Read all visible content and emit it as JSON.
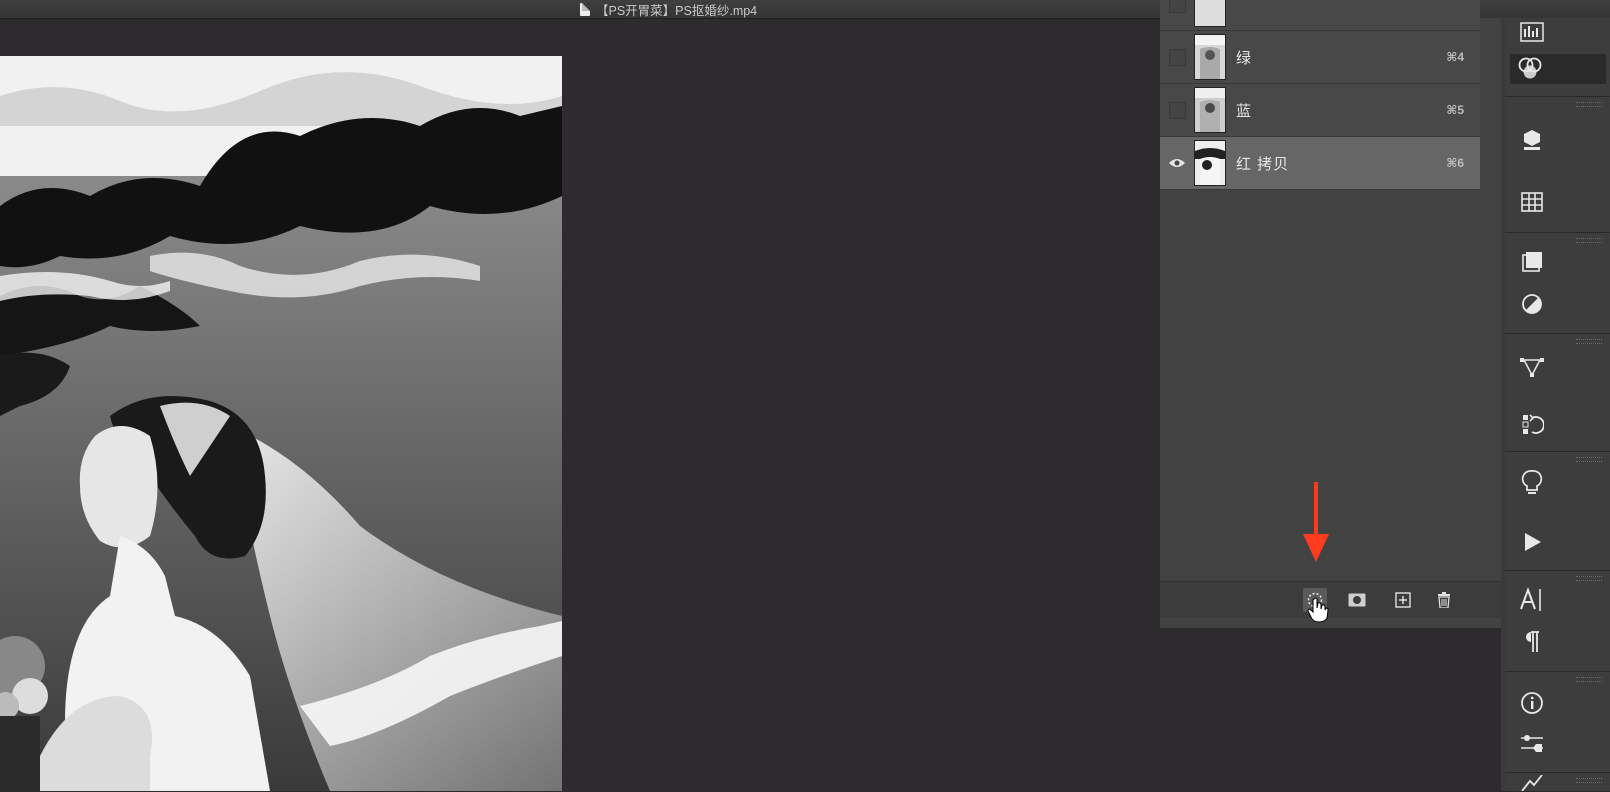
{
  "window": {
    "title": "【PS开胃菜】PS抠婚纱.mp4"
  },
  "layers": [
    {
      "name": "绿",
      "shortcut": "⌘4",
      "visible": false,
      "selected": false
    },
    {
      "name": "蓝",
      "shortcut": "⌘5",
      "visible": false,
      "selected": false
    },
    {
      "name": "红 拷贝",
      "shortcut": "⌘6",
      "visible": true,
      "selected": true
    }
  ],
  "footer_buttons": [
    "load-channel-as-selection",
    "save-selection-as-channel",
    "new-channel",
    "delete-channel"
  ],
  "right_dock_icons": [
    "histogram-icon",
    "channels-icon",
    "3d-icon",
    "table-icon",
    "copy-source-icon",
    "adjustments-icon",
    "paths-icon",
    "history-icon",
    "lightbulb-icon",
    "actions-icon",
    "character-icon",
    "paragraph-icon",
    "info-icon",
    "properties-icon",
    "brush-settings-icon"
  ],
  "colors": {
    "accent_arrow": "#ff3b1f",
    "selected_row": "#666666",
    "panel_bg": "#424242"
  }
}
